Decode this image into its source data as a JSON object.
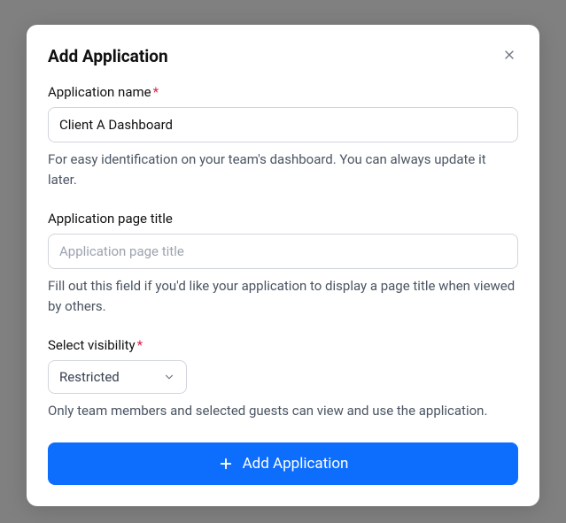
{
  "modal": {
    "title": "Add Application",
    "fields": {
      "app_name": {
        "label": "Application name",
        "value": "Client A Dashboard",
        "helper": "For easy identification on your team's dashboard. You can always update it later."
      },
      "page_title": {
        "label": "Application page title",
        "placeholder": "Application page title",
        "helper": "Fill out this field if you'd like your application to display a page title when viewed by others."
      },
      "visibility": {
        "label": "Select visibility",
        "selected": "Restricted",
        "helper": "Only team members and selected guests can view and use the application."
      }
    },
    "submit_label": "Add Application"
  }
}
